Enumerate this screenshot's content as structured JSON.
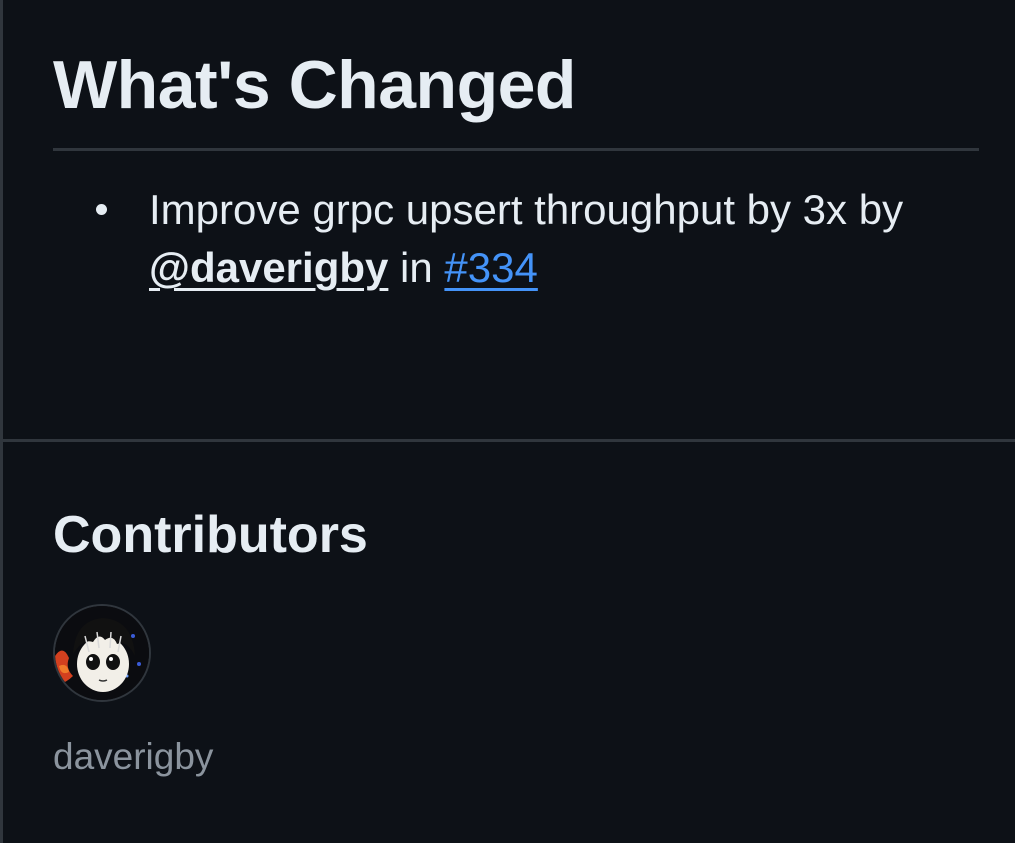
{
  "release": {
    "changes_heading": "What's Changed",
    "changes": [
      {
        "text_before": "Improve grpc upsert throughput by 3x by ",
        "author": "@daverigby",
        "text_middle": " in ",
        "pr": "#334"
      }
    ]
  },
  "contributors": {
    "heading": "Contributors",
    "people": [
      {
        "name": "daverigby",
        "avatar_icon": "avatar-image"
      }
    ]
  },
  "colors": {
    "background": "#0d1117",
    "text": "#e6edf3",
    "muted_text": "#8b949e",
    "link": "#4493f8",
    "border": "#30363d"
  }
}
